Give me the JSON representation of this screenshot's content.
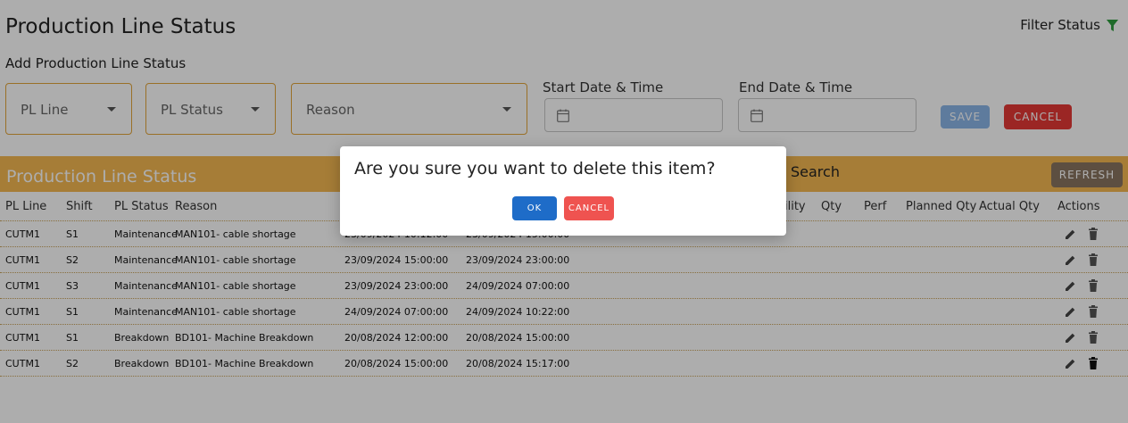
{
  "header": {
    "title": "Production Line Status",
    "filter_label": "Filter Status",
    "subtitle": "Add Production Line Status"
  },
  "form": {
    "pl_line_label": "PL Line",
    "pl_status_label": "PL Status",
    "reason_label": "Reason",
    "start_label": "Start Date & Time",
    "end_label": "End Date & Time",
    "save_label": "SAVE",
    "cancel_label": "CANCEL"
  },
  "table": {
    "title": "Production Line Status",
    "search_label": "Search",
    "refresh_label": "REFRESH",
    "columns": [
      "PL Line",
      "Shift",
      "PL Status",
      "Reason",
      "ility",
      "Qty",
      "Perf",
      "Planned Qty",
      "Actual Qty",
      "Actions"
    ],
    "rows": [
      {
        "line": "CUTM1",
        "shift": "S1",
        "status": "Maintenance",
        "reason": "MAN101- cable shortage",
        "start": "23/09/2024 10:12:00",
        "end": "23/09/2024 15:00:00"
      },
      {
        "line": "CUTM1",
        "shift": "S2",
        "status": "Maintenance",
        "reason": "MAN101- cable shortage",
        "start": "23/09/2024 15:00:00",
        "end": "23/09/2024 23:00:00"
      },
      {
        "line": "CUTM1",
        "shift": "S3",
        "status": "Maintenance",
        "reason": "MAN101- cable shortage",
        "start": "23/09/2024 23:00:00",
        "end": "24/09/2024 07:00:00"
      },
      {
        "line": "CUTM1",
        "shift": "S1",
        "status": "Maintenance",
        "reason": "MAN101- cable shortage",
        "start": "24/09/2024 07:00:00",
        "end": "24/09/2024 10:22:00"
      },
      {
        "line": "CUTM1",
        "shift": "S1",
        "status": "Breakdown",
        "reason": "BD101- Machine Breakdown",
        "start": "20/08/2024 12:00:00",
        "end": "20/08/2024 15:00:00"
      },
      {
        "line": "CUTM1",
        "shift": "S2",
        "status": "Breakdown",
        "reason": "BD101- Machine Breakdown",
        "start": "20/08/2024 15:00:00",
        "end": "20/08/2024 15:17:00"
      }
    ]
  },
  "dialog": {
    "message": "Are you sure you want to delete this item?",
    "ok_label": "OK",
    "cancel_label": "CANCEL"
  },
  "colors": {
    "accent": "#f5b952",
    "field_border": "#e3a53a",
    "ok": "#1e6cc8",
    "cancel": "#e53935",
    "filter_icon": "#2e9e3e"
  },
  "icons": {
    "filter": "funnel-icon",
    "date": "calendar-icon",
    "edit": "pencil-icon",
    "delete": "trash-icon"
  }
}
